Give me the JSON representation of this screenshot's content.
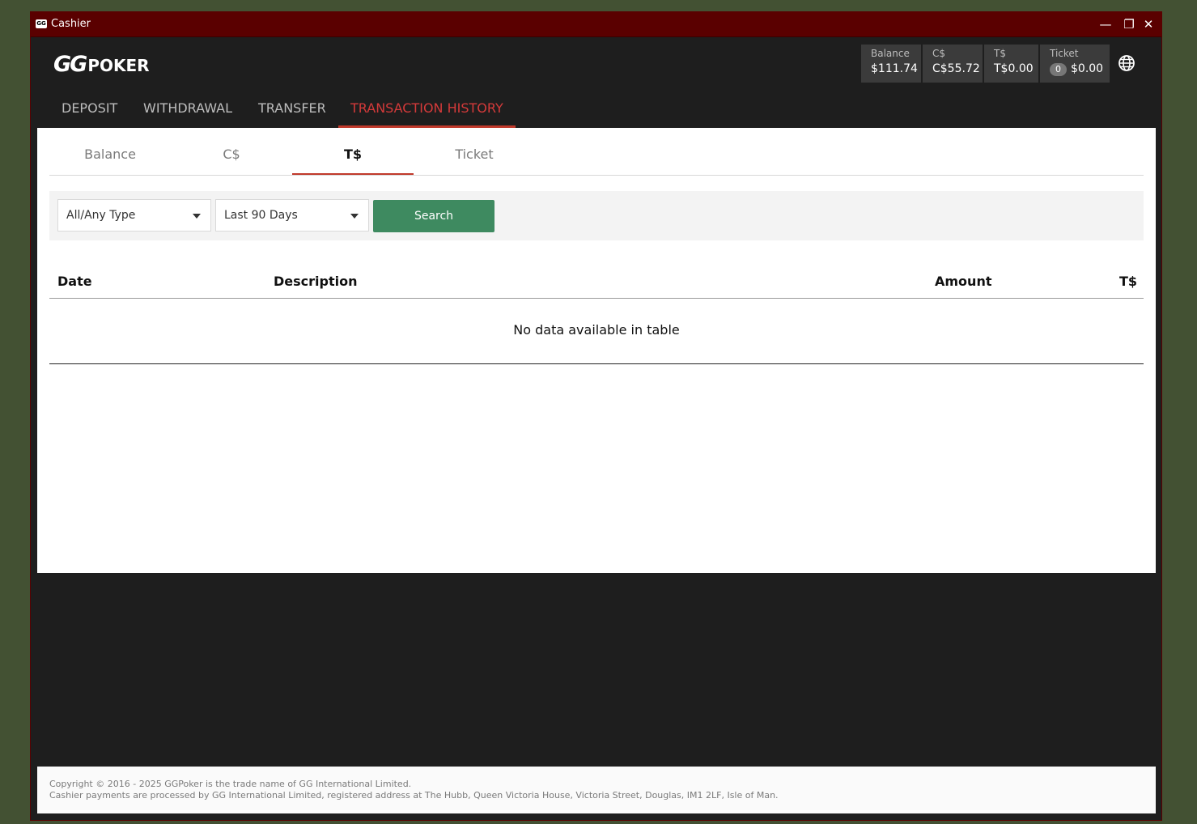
{
  "window": {
    "title": "Cashier",
    "title_logo": "GG",
    "minimize": "—",
    "restore": "❐",
    "close": "✕"
  },
  "brand": {
    "gg": "GG",
    "poker": "POKER"
  },
  "wallets": [
    {
      "label": "Balance",
      "value": "$111.74"
    },
    {
      "label": "C$",
      "value": "C$55.72"
    },
    {
      "label": "T$",
      "value": "T$0.00"
    },
    {
      "label": "Ticket",
      "count": "0",
      "value": "$0.00"
    }
  ],
  "main_tabs": [
    "DEPOSIT",
    "WITHDRAWAL",
    "TRANSFER",
    "TRANSACTION HISTORY"
  ],
  "sub_tabs": [
    "Balance",
    "C$",
    "T$",
    "Ticket"
  ],
  "filters": {
    "type": "All/Any Type",
    "period": "Last 90 Days",
    "search_label": "Search"
  },
  "table": {
    "columns": [
      "Date",
      "Description",
      "Amount",
      "T$"
    ],
    "empty_message": "No data available in table"
  },
  "footer": {
    "line1": "Copyright © 2016 - 2025 GGPoker is the trade name of GG International Limited.",
    "line2": "Cashier payments are processed by GG International Limited, registered address at The Hubb, Queen Victoria House, Victoria Street, Douglas, IM1 2LF, Isle of Man."
  },
  "colors": {
    "accent": "#c0392b",
    "search_button": "#3e8a60",
    "titlebar": "#5a0000"
  }
}
